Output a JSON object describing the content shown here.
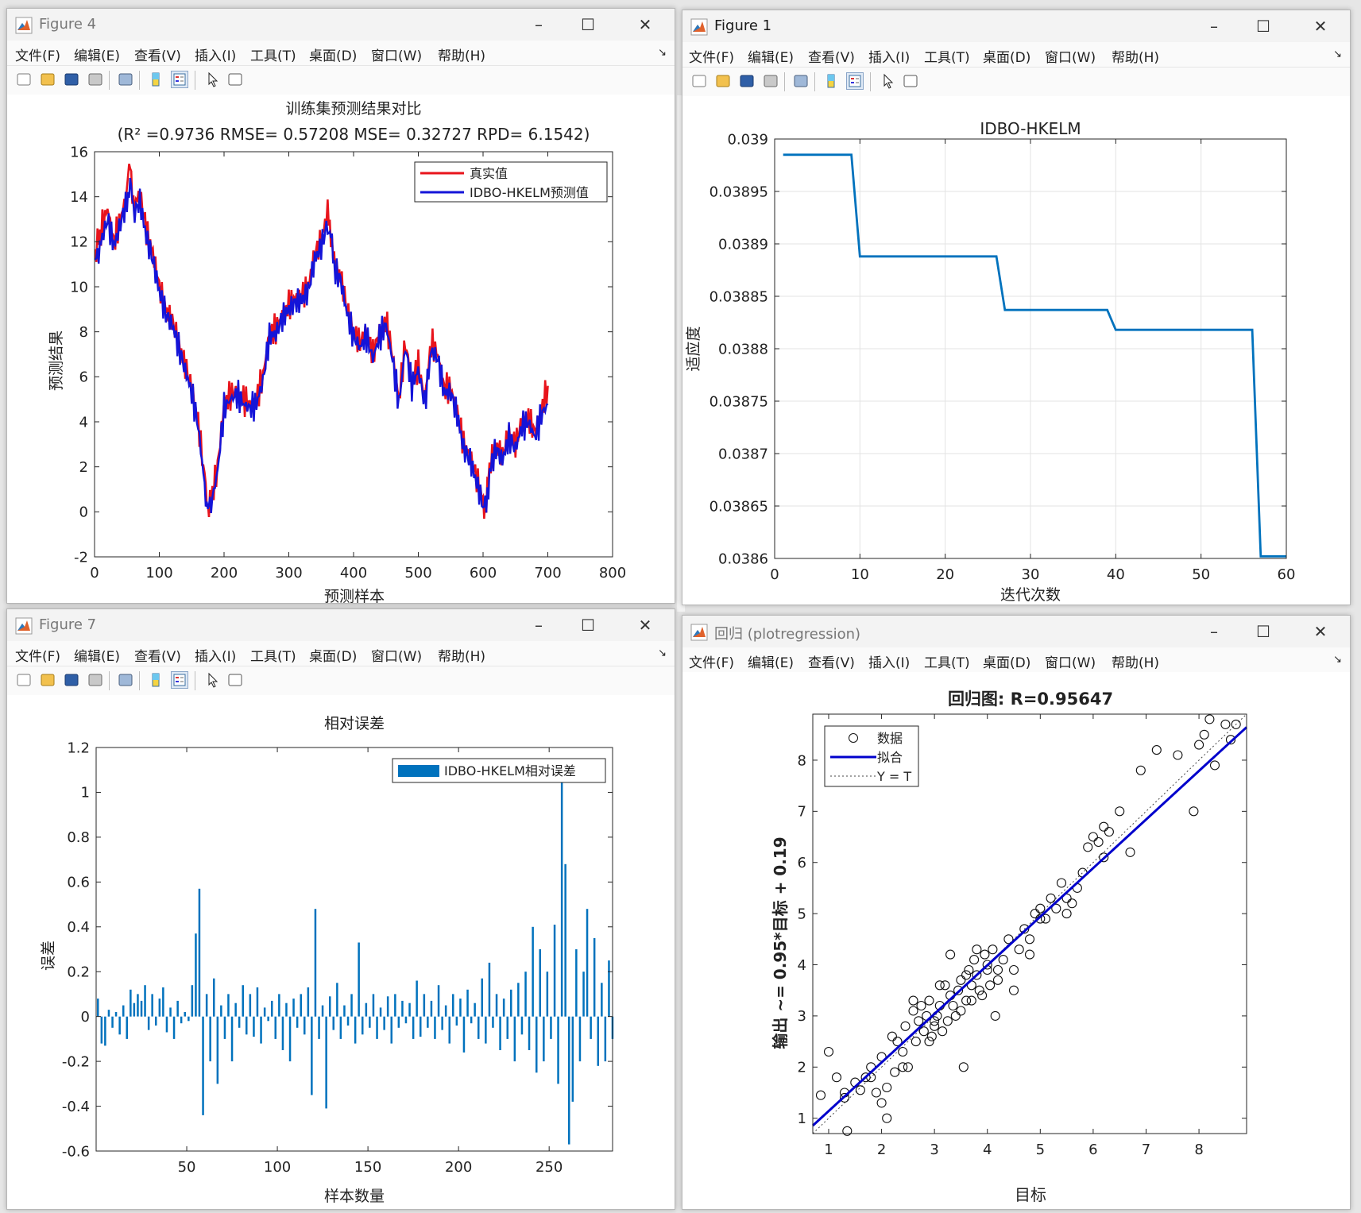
{
  "windows": {
    "fig4": {
      "title": "Figure 4",
      "menu": [
        "文件(F)",
        "编辑(E)",
        "查看(V)",
        "插入(I)",
        "工具(T)",
        "桌面(D)",
        "窗口(W)",
        "帮助(H)"
      ]
    },
    "fig1": {
      "title": "Figure 1",
      "menu": [
        "文件(F)",
        "编辑(E)",
        "查看(V)",
        "插入(I)",
        "工具(T)",
        "桌面(D)",
        "窗口(W)",
        "帮助(H)"
      ]
    },
    "fig7": {
      "title": "Figure 7",
      "menu": [
        "文件(F)",
        "编辑(E)",
        "查看(V)",
        "插入(I)",
        "工具(T)",
        "桌面(D)",
        "窗口(W)",
        "帮助(H)"
      ]
    },
    "reg": {
      "title": "回归 (plotregression)",
      "menu": [
        "文件(F)",
        "编辑(E)",
        "查看(V)",
        "插入(I)",
        "工具(T)",
        "桌面(D)",
        "窗口(W)",
        "帮助(H)"
      ]
    }
  },
  "colors": {
    "red": "#e8141c",
    "blue": "#1414d8",
    "matlab_blue": "#0072bd",
    "fit_blue": "#0000cc"
  },
  "icons": [
    "new-file-icon",
    "open-folder-icon",
    "save-icon",
    "print-icon",
    "print-preview-icon",
    "colorbar-icon",
    "legend-icon",
    "pointer-icon",
    "property-inspector-icon"
  ],
  "chart_data": [
    {
      "id": "fig4",
      "type": "line",
      "title": "训练集预测结果对比",
      "subtitle": "(R² =0.9736 RMSE= 0.57208 MSE= 0.32727 RPD= 6.1542)",
      "xlabel": "预测样本",
      "ylabel": "预测结果",
      "xlim": [
        0,
        800
      ],
      "ylim": [
        -2,
        16
      ],
      "xticks": [
        "0",
        "100",
        "200",
        "300",
        "400",
        "500",
        "600",
        "700",
        "800"
      ],
      "yticks": [
        "-2",
        "0",
        "2",
        "4",
        "6",
        "8",
        "10",
        "12",
        "14",
        "16"
      ],
      "legend_position": "top-right",
      "series": [
        {
          "name": "真实值",
          "color": "#e8141c",
          "x": [
            1,
            10,
            20,
            30,
            40,
            50,
            55,
            60,
            70,
            80,
            90,
            100,
            110,
            120,
            130,
            140,
            150,
            160,
            170,
            175,
            180,
            190,
            200,
            210,
            220,
            230,
            240,
            250,
            260,
            270,
            280,
            290,
            300,
            310,
            320,
            330,
            340,
            350,
            360,
            365,
            370,
            380,
            390,
            400,
            410,
            420,
            430,
            440,
            450,
            460,
            470,
            480,
            490,
            500,
            510,
            520,
            530,
            540,
            550,
            560,
            570,
            580,
            590,
            600,
            605,
            610,
            620,
            630,
            640,
            650,
            660,
            670,
            680,
            690,
            700
          ],
          "y": [
            11.5,
            12.5,
            13.5,
            12.0,
            13.0,
            14.2,
            15.8,
            13.5,
            14.2,
            12.5,
            11.5,
            10.0,
            9.0,
            8.5,
            7.5,
            6.5,
            5.5,
            4.0,
            1.5,
            0.3,
            0.5,
            2.0,
            4.8,
            5.2,
            5.4,
            5.0,
            4.8,
            5.0,
            6.0,
            8.0,
            8.1,
            8.8,
            9.2,
            9.5,
            9.6,
            10.0,
            11.5,
            12.0,
            13.4,
            12.5,
            11.0,
            10.5,
            9.0,
            8.0,
            7.5,
            8.0,
            7.0,
            8.0,
            8.5,
            7.0,
            5.0,
            7.5,
            5.8,
            6.5,
            5.0,
            7.5,
            7.0,
            5.5,
            5.5,
            4.5,
            3.0,
            2.5,
            1.5,
            0.5,
            0.3,
            2.0,
            3.0,
            2.5,
            3.5,
            3.0,
            4.0,
            4.2,
            3.5,
            4.5,
            5.6
          ]
        },
        {
          "name": "IDBO-HKELM预测值",
          "color": "#1414d8",
          "x": [
            1,
            10,
            20,
            30,
            40,
            50,
            55,
            60,
            70,
            80,
            90,
            100,
            110,
            120,
            130,
            140,
            150,
            160,
            170,
            175,
            180,
            190,
            200,
            210,
            220,
            230,
            240,
            250,
            260,
            270,
            280,
            290,
            300,
            310,
            320,
            330,
            340,
            350,
            360,
            365,
            370,
            380,
            390,
            400,
            410,
            420,
            430,
            440,
            450,
            460,
            470,
            480,
            490,
            500,
            510,
            520,
            530,
            540,
            550,
            560,
            570,
            580,
            590,
            600,
            605,
            610,
            620,
            630,
            640,
            650,
            660,
            670,
            680,
            690,
            700
          ],
          "y": [
            11.0,
            12.0,
            13.0,
            11.8,
            12.8,
            13.8,
            14.8,
            13.2,
            13.8,
            12.2,
            11.2,
            9.8,
            8.8,
            8.3,
            7.3,
            6.3,
            5.3,
            3.8,
            1.2,
            0.0,
            0.3,
            1.8,
            4.6,
            5.0,
            5.2,
            4.8,
            4.6,
            4.8,
            5.8,
            7.8,
            7.9,
            8.6,
            9.0,
            9.3,
            9.4,
            9.8,
            11.2,
            11.8,
            12.8,
            12.2,
            10.8,
            10.3,
            8.8,
            7.8,
            7.3,
            7.8,
            6.8,
            7.8,
            8.3,
            6.8,
            4.8,
            7.3,
            5.6,
            6.3,
            4.8,
            7.2,
            6.8,
            5.3,
            5.3,
            4.3,
            2.8,
            2.3,
            1.3,
            0.3,
            0.1,
            1.8,
            2.8,
            2.3,
            3.3,
            2.8,
            3.8,
            4.0,
            3.3,
            4.3,
            4.8
          ]
        }
      ]
    },
    {
      "id": "fig1",
      "type": "line",
      "title": "IDBO-HKELM",
      "xlabel": "迭代次数",
      "ylabel": "适应度",
      "xlim": [
        0,
        60
      ],
      "ylim": [
        0.0386,
        0.039
      ],
      "xticks": [
        "0",
        "10",
        "20",
        "30",
        "40",
        "50",
        "60"
      ],
      "yticks": [
        "0.0386",
        "0.03865",
        "0.0387",
        "0.03875",
        "0.0388",
        "0.03885",
        "0.0389",
        "0.03895",
        "0.039"
      ],
      "grid": true,
      "series": [
        {
          "color": "#0072bd",
          "x": [
            1,
            9,
            10,
            26,
            27,
            39,
            40,
            56,
            57,
            60
          ],
          "y": [
            0.038985,
            0.038985,
            0.038888,
            0.038888,
            0.038837,
            0.038837,
            0.038818,
            0.038818,
            0.038602,
            0.038602
          ]
        }
      ]
    },
    {
      "id": "fig7",
      "type": "bar",
      "title": "相对误差",
      "xlabel": "样本数量",
      "ylabel": "误差",
      "xlim": [
        0,
        285
      ],
      "ylim": [
        -0.6,
        1.2
      ],
      "xticks": [
        "50",
        "100",
        "150",
        "200",
        "250"
      ],
      "yticks": [
        "-0.6",
        "-0.4",
        "-0.2",
        "0",
        "0.2",
        "0.4",
        "0.6",
        "0.8",
        "1",
        "1.2"
      ],
      "legend_position": "top-right",
      "series": [
        {
          "name": "IDBO-HKELM相对误差",
          "color": "#0072bd",
          "x": [
            1,
            3,
            5,
            7,
            9,
            11,
            13,
            15,
            17,
            19,
            21,
            23,
            25,
            27,
            29,
            31,
            33,
            35,
            37,
            39,
            41,
            43,
            45,
            47,
            49,
            51,
            53,
            55,
            57,
            59,
            61,
            63,
            65,
            67,
            69,
            71,
            73,
            75,
            77,
            79,
            81,
            83,
            85,
            87,
            89,
            91,
            93,
            95,
            97,
            99,
            101,
            103,
            105,
            107,
            109,
            111,
            113,
            115,
            117,
            119,
            121,
            123,
            125,
            127,
            129,
            131,
            133,
            135,
            137,
            139,
            141,
            143,
            145,
            147,
            149,
            151,
            153,
            155,
            157,
            159,
            161,
            163,
            165,
            167,
            169,
            171,
            173,
            175,
            177,
            179,
            181,
            183,
            185,
            187,
            189,
            191,
            193,
            195,
            197,
            199,
            201,
            203,
            205,
            207,
            209,
            211,
            213,
            215,
            217,
            219,
            221,
            223,
            225,
            227,
            229,
            231,
            233,
            235,
            237,
            239,
            241,
            243,
            245,
            247,
            249,
            251,
            253,
            255,
            257,
            259,
            261,
            263,
            265,
            267,
            269,
            271,
            273,
            275,
            277,
            279,
            281,
            283,
            285
          ],
          "y": [
            0.08,
            -0.12,
            -0.13,
            0.03,
            -0.05,
            0.02,
            -0.08,
            0.05,
            -0.1,
            0.12,
            0.06,
            0.1,
            0.07,
            0.14,
            -0.06,
            0.1,
            -0.04,
            0.08,
            0.13,
            -0.07,
            0.04,
            -0.1,
            0.07,
            -0.03,
            0.02,
            -0.02,
            0.14,
            0.37,
            0.57,
            -0.44,
            0.1,
            -0.2,
            0.17,
            -0.3,
            0.05,
            -0.1,
            0.1,
            -0.2,
            0.06,
            -0.05,
            0.14,
            -0.08,
            0.1,
            -0.09,
            0.13,
            -0.12,
            0.04,
            -0.02,
            0.07,
            -0.1,
            0.1,
            -0.15,
            0.06,
            -0.2,
            0.08,
            -0.05,
            0.1,
            -0.08,
            0.13,
            -0.35,
            0.48,
            -0.1,
            0.05,
            -0.41,
            0.09,
            -0.06,
            0.15,
            -0.1,
            0.05,
            -0.04,
            0.1,
            -0.12,
            0.33,
            -0.08,
            0.06,
            -0.05,
            0.1,
            -0.1,
            0.04,
            -0.06,
            0.09,
            -0.12,
            0.1,
            -0.05,
            0.07,
            -0.03,
            0.06,
            -0.1,
            0.16,
            -0.09,
            0.1,
            -0.05,
            0.07,
            -0.1,
            0.14,
            -0.06,
            0.05,
            -0.12,
            0.1,
            -0.04,
            0.08,
            -0.16,
            0.12,
            -0.03,
            0.06,
            -0.1,
            0.17,
            -0.12,
            0.24,
            -0.05,
            0.1,
            -0.15,
            0.08,
            -0.1,
            0.12,
            -0.2,
            0.15,
            -0.08,
            0.2,
            -0.15,
            0.4,
            -0.25,
            0.3,
            -0.2,
            0.2,
            -0.1,
            0.41,
            -0.3,
            1.05,
            0.68,
            -0.57,
            -0.38,
            0.3,
            -0.2,
            0.2,
            0.48,
            -0.1,
            0.35,
            -0.22,
            0.15,
            -0.2,
            0.25,
            -0.1
          ]
        }
      ]
    },
    {
      "id": "reg",
      "type": "scatter",
      "title": "回归图: R=0.95647",
      "xlabel": "目标",
      "ylabel": "输出 ~= 0.95*目标 + 0.19",
      "xlim": [
        0.7,
        8.9
      ],
      "ylim": [
        0.7,
        8.9
      ],
      "xticks": [
        "1",
        "2",
        "3",
        "4",
        "5",
        "6",
        "7",
        "8"
      ],
      "yticks": [
        "1",
        "2",
        "3",
        "4",
        "5",
        "6",
        "7",
        "8"
      ],
      "legend_position": "top-left",
      "legend": [
        "数据",
        "拟合",
        "Y = T"
      ],
      "fit": {
        "slope": 0.95,
        "intercept": 0.19
      },
      "points": {
        "x": [
          0.85,
          1.0,
          1.15,
          1.3,
          1.35,
          1.5,
          1.6,
          1.7,
          1.8,
          1.9,
          2.0,
          2.0,
          2.1,
          2.2,
          2.25,
          2.3,
          2.4,
          2.45,
          2.5,
          2.6,
          2.65,
          2.7,
          2.75,
          2.8,
          2.85,
          2.9,
          2.95,
          3.0,
          3.05,
          3.1,
          3.15,
          3.2,
          3.25,
          3.3,
          3.35,
          3.4,
          3.45,
          3.5,
          3.55,
          3.6,
          3.65,
          3.7,
          3.75,
          3.8,
          3.85,
          3.9,
          3.95,
          4.0,
          4.05,
          4.1,
          4.15,
          4.2,
          4.3,
          4.4,
          4.5,
          4.6,
          4.7,
          4.8,
          4.9,
          5.0,
          5.1,
          5.2,
          5.3,
          5.4,
          5.5,
          5.6,
          5.7,
          5.8,
          5.9,
          6.0,
          6.1,
          6.2,
          6.3,
          6.5,
          6.7,
          6.9,
          7.2,
          7.6,
          7.9,
          8.0,
          8.1,
          8.2,
          8.3,
          8.5,
          8.6,
          8.7,
          1.3,
          2.1,
          3.6,
          3.3,
          4.5,
          5.0,
          2.6,
          2.9,
          3.5,
          3.1,
          3.8,
          4.2,
          1.8,
          2.4,
          3.0,
          3.7,
          4.0,
          4.8,
          5.5,
          6.2
        ],
        "y": [
          1.45,
          2.3,
          1.8,
          1.5,
          0.75,
          1.7,
          1.55,
          1.8,
          2.0,
          1.5,
          2.2,
          1.3,
          1.0,
          2.6,
          1.9,
          2.5,
          2.3,
          2.8,
          2.0,
          3.1,
          2.5,
          2.9,
          3.2,
          2.7,
          3.0,
          3.3,
          2.6,
          2.9,
          3.0,
          3.2,
          2.7,
          3.6,
          2.9,
          3.4,
          3.2,
          3.0,
          3.5,
          3.7,
          2.0,
          3.3,
          3.9,
          3.6,
          4.1,
          3.8,
          3.5,
          3.4,
          4.2,
          4.0,
          3.6,
          4.3,
          3.0,
          3.9,
          4.1,
          4.5,
          3.9,
          4.3,
          4.7,
          4.5,
          5.0,
          5.1,
          4.9,
          5.3,
          5.1,
          5.6,
          5.3,
          5.2,
          5.5,
          5.8,
          6.3,
          6.5,
          6.4,
          6.7,
          6.6,
          7.0,
          6.2,
          7.8,
          8.2,
          8.1,
          7.0,
          8.3,
          8.5,
          8.8,
          7.9,
          8.7,
          8.4,
          8.7,
          1.4,
          1.6,
          3.8,
          4.2,
          3.5,
          4.9,
          3.3,
          2.5,
          3.1,
          3.6,
          4.3,
          3.7,
          1.8,
          2.0,
          2.8,
          3.3,
          3.9,
          4.2,
          5.0,
          6.1
        ]
      }
    }
  ]
}
